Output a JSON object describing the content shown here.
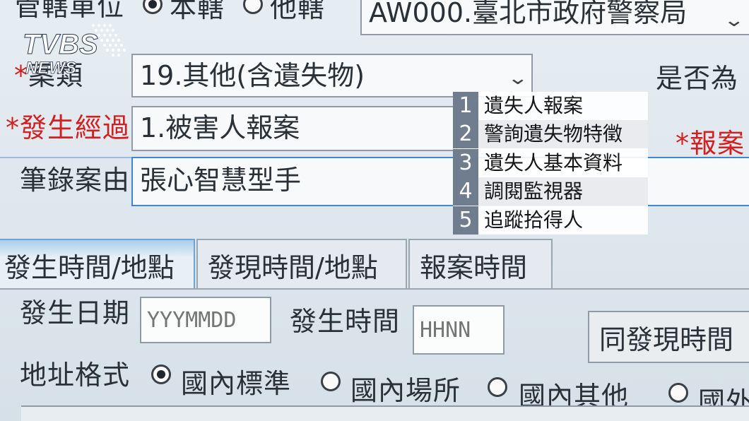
{
  "jurisdiction": {
    "label": "管轄單位",
    "radio_own": "本轄",
    "radio_other": "他轄",
    "agency_value": "AW000.臺北市政府警察局"
  },
  "case_type": {
    "label": "案類",
    "value": "19.其他(含遺失物)",
    "side_label": "是否為"
  },
  "occurrence": {
    "label": "發生經過",
    "value": "1.被害人報案",
    "side_label": "*報案"
  },
  "record_reason": {
    "label": "筆錄案由",
    "value": "張心智慧型手"
  },
  "tabs": [
    {
      "label": "發生時間/地點"
    },
    {
      "label": "發現時間/地點"
    },
    {
      "label": "報案時間"
    }
  ],
  "date_row": {
    "date_label": "發生日期",
    "date_placeholder": "YYYMMDD",
    "time_label": "發生時間",
    "time_placeholder": "HHNN",
    "same_button": "同發現時間"
  },
  "address_row": {
    "label": "地址格式",
    "options": [
      "國內標準",
      "國內場所",
      "國內其他",
      "國外"
    ]
  },
  "overlay_list": [
    {
      "num": "1",
      "text": "遺失人報案"
    },
    {
      "num": "2",
      "text": "警詢遺失物特徵"
    },
    {
      "num": "3",
      "text": "遺失人基本資料"
    },
    {
      "num": "4",
      "text": "調閱監視器"
    },
    {
      "num": "5",
      "text": "追蹤拾得人"
    }
  ],
  "logo": {
    "brand": "TVBS",
    "sub": "NEWS"
  },
  "colors": {
    "required": "#d21f1f",
    "focus_border": "#3f86d4",
    "overlay_num_bg": "#6f7d8e"
  }
}
